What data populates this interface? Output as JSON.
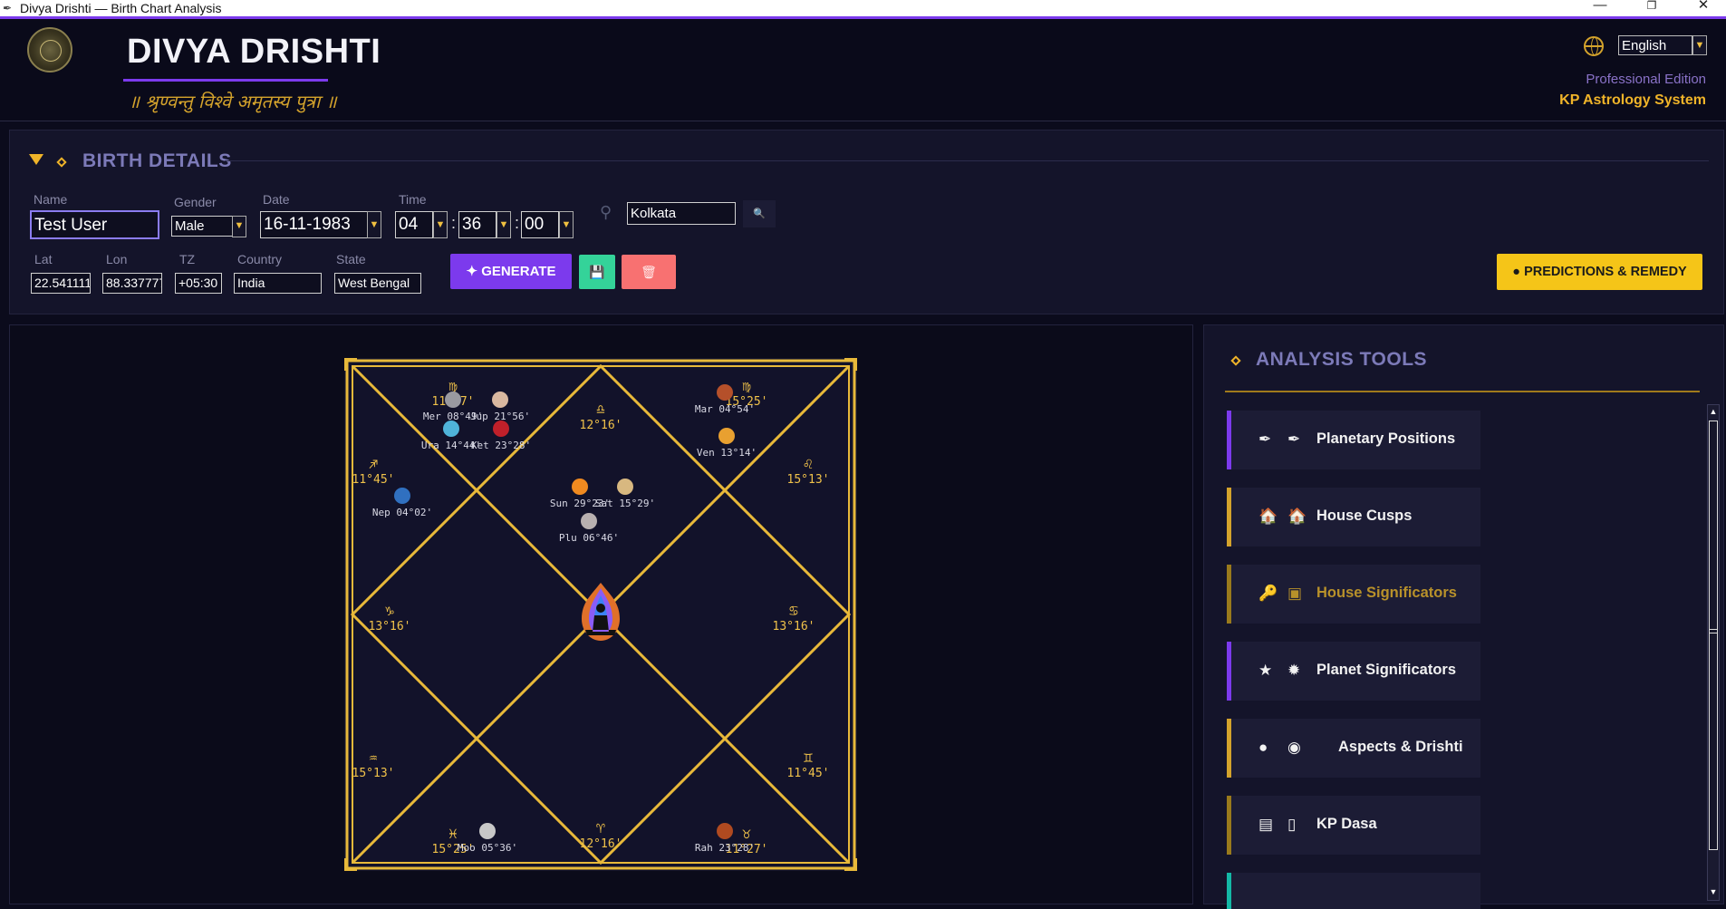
{
  "window": {
    "title": "Divya Drishti — Birth Chart Analysis",
    "controls": {
      "minimize": "—",
      "maximize": "❐",
      "close": "✕"
    }
  },
  "header": {
    "brand": "DIVYA DRISHTI",
    "tagline": "॥ श्रृण्वन्तु विश्वे अमृतस्य पुत्रा ॥",
    "language": "English",
    "edition": "Professional Edition",
    "system": "KP Astrology System"
  },
  "birth_details": {
    "title": "BIRTH DETAILS",
    "labels": {
      "name": "Name",
      "gender": "Gender",
      "date": "Date",
      "time": "Time",
      "lat": "Lat",
      "lon": "Lon",
      "tz": "TZ",
      "country": "Country",
      "state": "State"
    },
    "values": {
      "name": "Test User",
      "gender": "Male",
      "date": "16-11-1983",
      "hour": "04",
      "minute": "36",
      "second": "00",
      "city": "Kolkata",
      "lat": "22.541111",
      "lon": "88.337777",
      "tz": "+05:30",
      "country": "India",
      "state": "West Bengal"
    },
    "time_separator": ":",
    "buttons": {
      "generate": "GENERATE",
      "save_icon": "💾",
      "delete_icon": "🗑",
      "predictions": "PREDICTIONS & REMEDY"
    },
    "icons": {
      "generate_icon": "✦",
      "predictions_icon": "●",
      "search_icon": "🔍",
      "pin_icon": "⚲"
    }
  },
  "chart": {
    "center_icon": "meditating-figure-icon",
    "border_color": "#e8b93a",
    "text_color": "#f0c24a",
    "houses": [
      {
        "sign_symbol": "♍",
        "degree": "11°27'"
      },
      {
        "sign_symbol": "♎",
        "degree": "12°16'"
      },
      {
        "sign_symbol": "♍",
        "degree": "15°25'"
      },
      {
        "sign_symbol": "♌",
        "degree": "15°13'"
      },
      {
        "sign_symbol": "♋",
        "degree": "13°16'"
      },
      {
        "sign_symbol": "♊",
        "degree": "11°45'"
      },
      {
        "sign_symbol": "♉",
        "degree": "11°27'"
      },
      {
        "sign_symbol": "♈",
        "degree": "12°16'"
      },
      {
        "sign_symbol": "♓",
        "degree": "15°25'"
      },
      {
        "sign_symbol": "♒",
        "degree": "15°13'"
      },
      {
        "sign_symbol": "♑",
        "degree": "13°16'"
      },
      {
        "sign_symbol": "♐",
        "degree": "11°45'"
      }
    ],
    "planets": [
      {
        "label": "Mer 08°49'",
        "color": "#9a9aa0"
      },
      {
        "label": "Jup 21°56'",
        "color": "#d9b8a0"
      },
      {
        "label": "Ura 14°44'",
        "color": "#4fb3d9"
      },
      {
        "label": "Ket 23°28'",
        "color": "#c0202a"
      },
      {
        "label": "Mar 04°54'",
        "color": "#b5502a"
      },
      {
        "label": "Ven 13°14'",
        "color": "#e8a030"
      },
      {
        "label": "Sun 29°23'",
        "color": "#f08a20"
      },
      {
        "label": "Sat 15°29'",
        "color": "#d8b880"
      },
      {
        "label": "Plu 06°46'",
        "color": "#b8b0b0"
      },
      {
        "label": "Nep 04°02'",
        "color": "#3070c0"
      },
      {
        "label": "Moo 05°36'",
        "color": "#c8c8c8"
      },
      {
        "label": "Rah 23°28'",
        "color": "#b04a20"
      }
    ]
  },
  "analysis_tools": {
    "title": "ANALYSIS TOOLS",
    "items": [
      {
        "icon1": "✒",
        "icon2": "✒",
        "label": "Planetary Positions",
        "accent": "#7c3aed"
      },
      {
        "icon1": "🏠",
        "icon2": "🏠",
        "label": "House Cusps",
        "accent": "#d4a32c"
      },
      {
        "icon1": "🔑",
        "icon2": "▣",
        "label": "House Significators",
        "accent": "#9a7a1c"
      },
      {
        "icon1": "★",
        "icon2": "✹",
        "label": "Planet Significators",
        "accent": "#7c3aed"
      },
      {
        "icon1": "●",
        "icon2": "◉",
        "label": "Aspects & Drishti",
        "accent": "#d4a32c"
      },
      {
        "icon1": "▤",
        "icon2": "▯",
        "label": "KP Dasa",
        "accent": "#9a7a1c"
      },
      {
        "icon1": "",
        "icon2": "",
        "label": "",
        "accent": "#14b8a6"
      }
    ],
    "scroll_up": "▲",
    "scroll_down": "▼"
  }
}
